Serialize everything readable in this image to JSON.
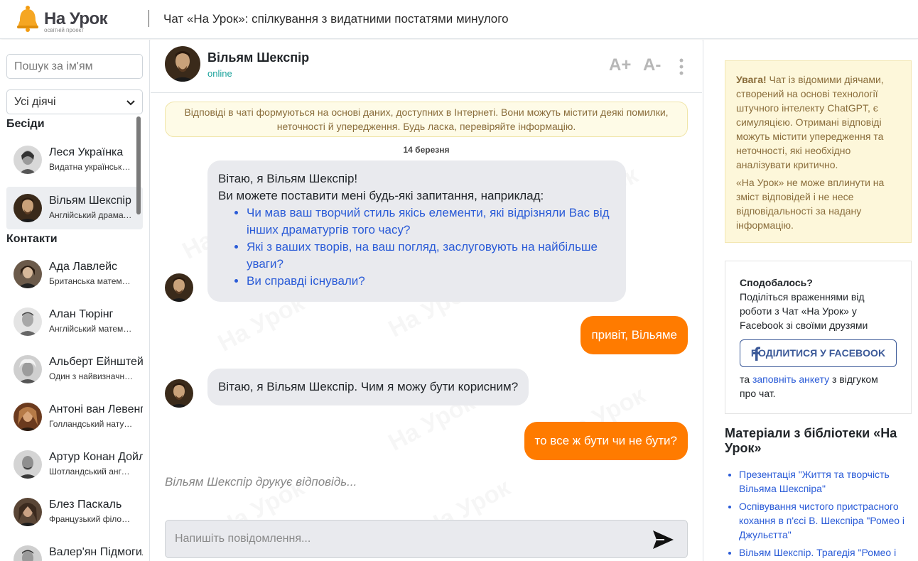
{
  "header": {
    "logo_name": "На Урок",
    "logo_sub": "освітній проект",
    "title": "Чат «На Урок»: спілкування з видатними постатями минулого"
  },
  "sidebar": {
    "search_placeholder": "Пошук за ім'ям",
    "filter_value": "Усі діячі",
    "conversations_title": "Бесіди",
    "contacts_title": "Контакти",
    "conversations": [
      {
        "name": "Леся Українка",
        "desc": "Видатна українська поетеса",
        "active": false
      },
      {
        "name": "Вільям Шекспір",
        "desc": "Англійський драматург",
        "active": true
      }
    ],
    "contacts": [
      {
        "name": "Ада Лавлейс",
        "desc": "Британська математикиня"
      },
      {
        "name": "Алан Тюрінг",
        "desc": "Англійський математик"
      },
      {
        "name": "Альберт Ейнштейн",
        "desc": "Один з найвизначніших фізиків"
      },
      {
        "name": "Антоні ван Левенгук",
        "desc": "Голландський натураліст"
      },
      {
        "name": "Артур Конан Дойл",
        "desc": "Шотландський англомовний письменник"
      },
      {
        "name": "Блез Паскаль",
        "desc": "Французький філософ"
      },
      {
        "name": "Валер'ян Підмогильний",
        "desc": ""
      }
    ]
  },
  "chat": {
    "name": "Вільям Шекспір",
    "status": "online",
    "font_up": "A+",
    "font_down": "A-",
    "disclaimer_line1": "Відповіді в чаті формуються на основі даних, доступних в Інтернеті. Вони можуть містити деякі помилки,",
    "disclaimer_line2": "неточності й упередження. Будь ласка, перевіряйте інформацію.",
    "date": "14 березня",
    "greeting_line1": "Вітаю, я Вільям Шекспір!",
    "greeting_line2": "Ви можете поставити мені будь-які запитання, наприклад:",
    "suggestions": [
      "Чи мав ваш творчий стиль якісь елементи, які відрізняли Вас від інших драматургів того часу?",
      "Які з ваших творів, на ваш погляд, заслуговують на найбільше уваги?",
      "Ви справді існували?"
    ],
    "user_msg1": "привіт, Вільяме",
    "bot_msg2": "Вітаю, я Вільям Шекспір. Чим я можу бути корисним?",
    "user_msg2": "то все ж бути чи не бути?",
    "typing": "Вільям Шекспір друкує відповідь...",
    "compose_placeholder": "Напишіть повідомлення...",
    "watermark": "На Урок"
  },
  "right": {
    "warn_bold": "Увага!",
    "warn_text": " Чат із відомими діячами, створений на основі технології штучного інтелекту ChatGPT, є симуляцією. Отримані відповіді можуть містити упередження та неточності, які необхідно аналізувати критично.",
    "warn_text2": "«На Урок» не може вплинути на зміст відповідей і не несе відповідальності за надану інформацію.",
    "share_title": "Сподобалось?",
    "share_text": "Поділіться враженнями від роботи з Чат «На Урок» у Facebook зі своїми друзями",
    "fb_button": "ПОДІЛИТИСЯ У FACEBOOK",
    "foot_pre": "та ",
    "foot_link": "заповніть анкету",
    "foot_post": " з відгуком про чат.",
    "lib_title": "Матеріали з бібліотеки «На Урок»",
    "lib_items": [
      "Презентація \"Життя та творчість Вільяма Шекспіра\"",
      "Оспівування чистого пристрасного кохання в п'єсі В. Шекспіра \"Ромео і Джульєтта\"",
      "Вільям Шекспір. Трагедія \"Ромео і Джульєтта\""
    ]
  },
  "colors": {
    "accent": "#ff7b00",
    "bubble_in": "#e9eaee",
    "link": "#2a5bd7",
    "online": "#1ba39c",
    "warn_bg": "#fdf7da"
  }
}
